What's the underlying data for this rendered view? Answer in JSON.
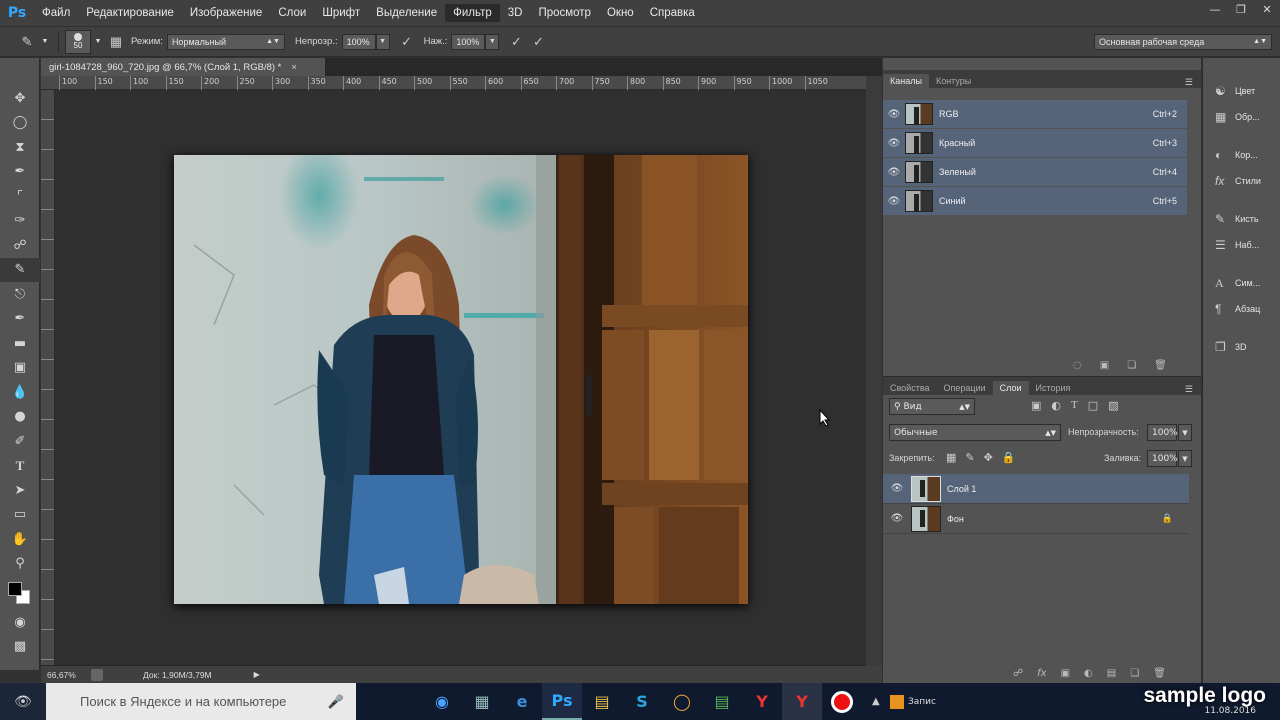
{
  "app": {
    "logo": "Ps"
  },
  "menu": [
    "Файл",
    "Редактирование",
    "Изображение",
    "Слои",
    "Шрифт",
    "Выделение",
    "Фильтр",
    "3D",
    "Просмотр",
    "Окно",
    "Справка"
  ],
  "menu_active": "Фильтр",
  "options": {
    "brush_size": "50",
    "mode_label": "Режим:",
    "mode_value": "Нормальный",
    "opacity_label": "Непрозр.:",
    "opacity_value": "100%",
    "flow_label": "Наж.:",
    "flow_value": "100%",
    "workspace": "Основная рабочая среда"
  },
  "document": {
    "tab_title": "girl-1084728_960_720.jpg @ 66,7% (Слой 1, RGB/8) *",
    "ruler_ticks": [
      "100",
      "150",
      "100",
      "150",
      "200",
      "250",
      "300",
      "350",
      "400",
      "450",
      "500",
      "550",
      "600",
      "650",
      "700",
      "750",
      "800",
      "850",
      "900",
      "950",
      "1000",
      "1050"
    ],
    "zoom": "66,67%",
    "doc_info": "Док: 1,90M/3,79M"
  },
  "channels": {
    "tabs": [
      "Каналы",
      "Контуры"
    ],
    "rows": [
      {
        "name": "RGB",
        "shortcut": "Ctrl+2"
      },
      {
        "name": "Красный",
        "shortcut": "Ctrl+3"
      },
      {
        "name": "Зеленый",
        "shortcut": "Ctrl+4"
      },
      {
        "name": "Синий",
        "shortcut": "Ctrl+5"
      }
    ]
  },
  "layers": {
    "tabs": [
      "Свойства",
      "Операции",
      "Слои",
      "История"
    ],
    "filter_kind": "Вид",
    "blend_mode": "Обычные",
    "opacity_label": "Непрозрачность:",
    "opacity_value": "100%",
    "lock_label": "Закрепить:",
    "fill_label": "Заливка:",
    "fill_value": "100%",
    "rows": [
      {
        "name": "Слой 1"
      },
      {
        "name": "Фон"
      }
    ]
  },
  "dock": [
    {
      "icon": "color-icon",
      "label": "Цвет"
    },
    {
      "icon": "swatches-icon",
      "label": "Обр..."
    },
    {
      "icon": "adjustments-icon",
      "label": "Кор..."
    },
    {
      "icon": "styles-icon",
      "label": "Стили"
    },
    {
      "icon": "brush-icon",
      "label": "Кисть"
    },
    {
      "icon": "brush-presets-icon",
      "label": "Наб..."
    },
    {
      "icon": "character-icon",
      "label": "Сим..."
    },
    {
      "icon": "paragraph-icon",
      "label": "Абзац"
    },
    {
      "icon": "3d-icon",
      "label": "3D"
    }
  ],
  "taskbar": {
    "search_placeholder": "Поиск в Яндексе и на компьютере",
    "watermark": "sample logo",
    "date": "11.08.2016",
    "tray_text": "Запис"
  }
}
